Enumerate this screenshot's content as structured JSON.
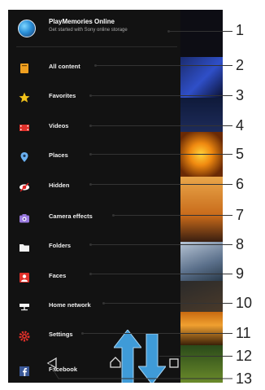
{
  "header": {
    "title": "PlayMemories Online",
    "subtitle": "Get started with Sony online storage"
  },
  "menu": [
    {
      "label": "All content",
      "icon": "all-content-icon"
    },
    {
      "label": "Favorites",
      "icon": "star-icon"
    },
    {
      "label": "Videos",
      "icon": "video-icon"
    },
    {
      "label": "Places",
      "icon": "map-pin-icon"
    },
    {
      "label": "Hidden",
      "icon": "hidden-eye-icon"
    },
    {
      "label": "Camera effects",
      "icon": "camera-icon"
    },
    {
      "label": "Folders",
      "icon": "folder-icon"
    },
    {
      "label": "Faces",
      "icon": "faces-icon"
    },
    {
      "label": "Home network",
      "icon": "home-network-icon"
    },
    {
      "label": "Settings",
      "icon": "gear-icon"
    },
    {
      "label": "Facebook",
      "icon": "facebook-icon"
    }
  ],
  "callouts": [
    "1",
    "2",
    "3",
    "4",
    "5",
    "6",
    "7",
    "8",
    "9",
    "10",
    "11",
    "12",
    "13"
  ],
  "colors": {
    "drawer_bg": "#121212",
    "accent_orange": "#f0a020",
    "accent_blue": "#4a90d9",
    "arrow_blue": "#3f9bd8"
  }
}
